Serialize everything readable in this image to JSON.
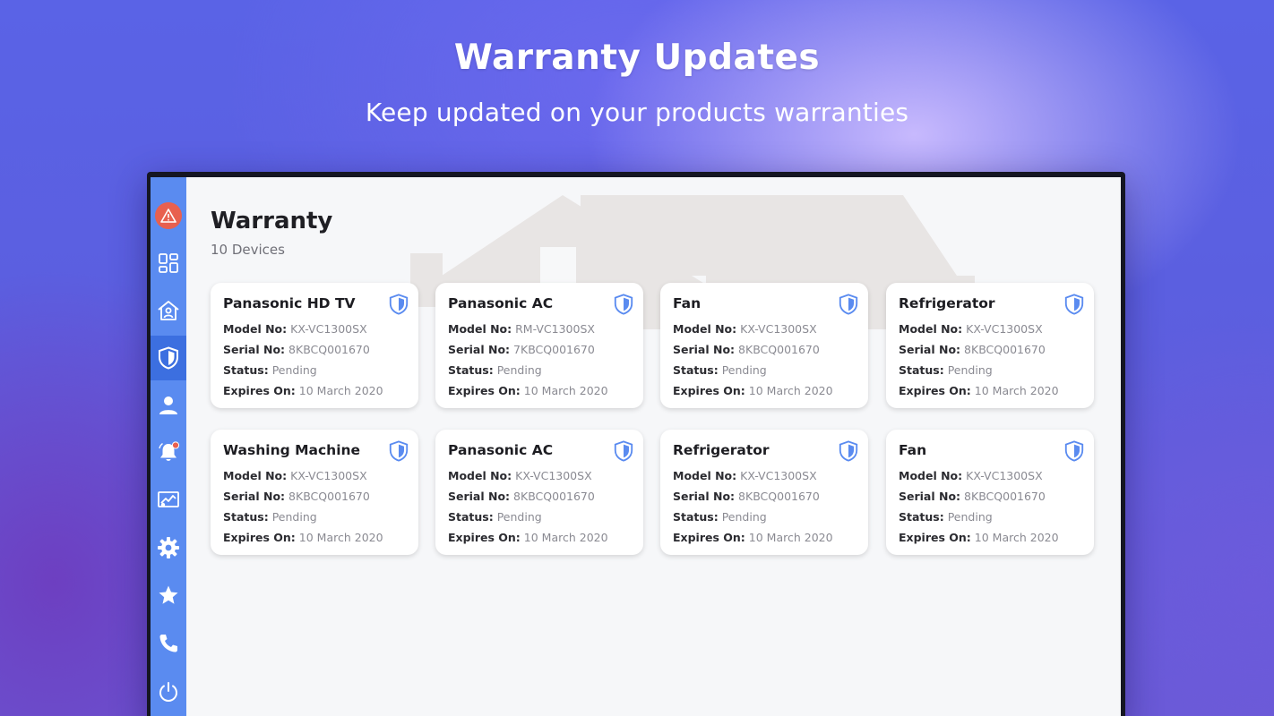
{
  "promo": {
    "title": "Warranty Updates",
    "subtitle": "Keep updated on your products warranties"
  },
  "page": {
    "title": "Warranty",
    "device_count": "10 Devices"
  },
  "labels": {
    "model": "Model No:",
    "serial": "Serial No:",
    "status": "Status:",
    "expires": "Expires On:"
  },
  "sidebar": {
    "accent": "#5a8bf0",
    "active_color": "#3c6fe0",
    "alert_color": "#e8604f",
    "items": [
      {
        "icon": "alert-icon"
      },
      {
        "icon": "dashboard-icon"
      },
      {
        "icon": "home-icon"
      },
      {
        "icon": "shield-icon",
        "active": true
      },
      {
        "icon": "user-icon"
      },
      {
        "icon": "bell-icon",
        "badge": true
      },
      {
        "icon": "screen-icon"
      },
      {
        "icon": "gear-icon"
      },
      {
        "icon": "star-icon"
      },
      {
        "icon": "phone-icon"
      },
      {
        "icon": "power-icon"
      }
    ]
  },
  "cards": [
    {
      "name": "Panasonic HD TV",
      "model": "KX-VC1300SX",
      "serial": "8KBCQ001670",
      "status": "Pending",
      "expires": "10 March 2020"
    },
    {
      "name": "Panasonic AC",
      "model": "RM-VC1300SX",
      "serial": "7KBCQ001670",
      "status": "Pending",
      "expires": "10 March 2020"
    },
    {
      "name": "Fan",
      "model": "KX-VC1300SX",
      "serial": "8KBCQ001670",
      "status": "Pending",
      "expires": "10 March 2020"
    },
    {
      "name": "Refrigerator",
      "model": "KX-VC1300SX",
      "serial": "8KBCQ001670",
      "status": "Pending",
      "expires": "10 March 2020"
    },
    {
      "name": "Washing Machine",
      "model": "KX-VC1300SX",
      "serial": "8KBCQ001670",
      "status": "Pending",
      "expires": "10 March 2020"
    },
    {
      "name": "Panasonic AC",
      "model": "KX-VC1300SX",
      "serial": "8KBCQ001670",
      "status": "Pending",
      "expires": "10 March 2020"
    },
    {
      "name": "Refrigerator",
      "model": "KX-VC1300SX",
      "serial": "8KBCQ001670",
      "status": "Pending",
      "expires": "10 March 2020"
    },
    {
      "name": "Fan",
      "model": "KX-VC1300SX",
      "serial": "8KBCQ001670",
      "status": "Pending",
      "expires": "10 March 2020"
    }
  ]
}
